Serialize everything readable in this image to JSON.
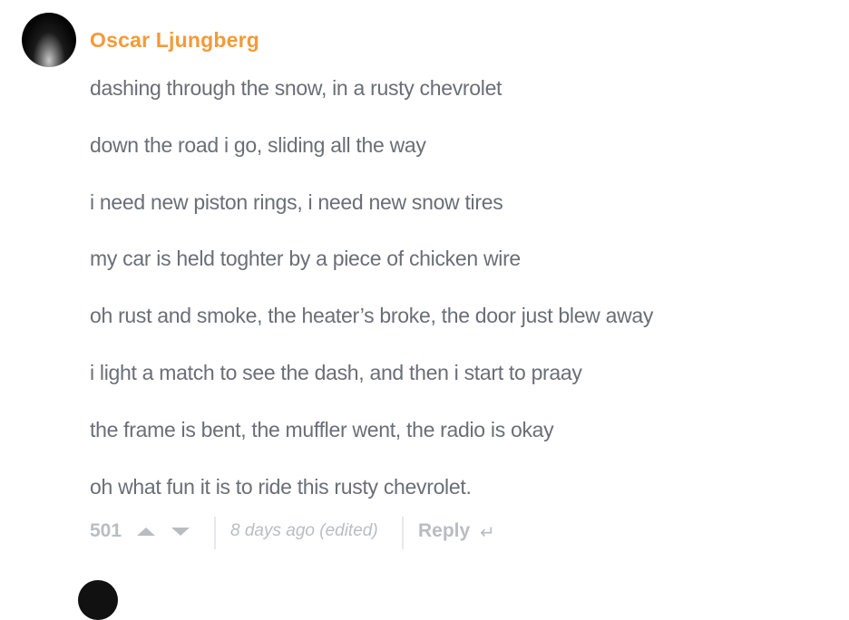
{
  "comment": {
    "author": "Oscar Ljungberg",
    "lines": [
      "dashing through the snow, in a rusty chevrolet",
      "down the road i go, sliding all the way",
      "i need new piston rings, i need new snow tires",
      "my car is held toghter by a piece of chicken wire",
      "oh rust and smoke, the heater’s broke, the door just blew away",
      "i light a match to see the dash, and then i start to praay",
      "the frame is bent, the muffler went, the radio is okay",
      "oh what fun it is to ride this rusty chevrolet."
    ],
    "votes": "501",
    "time": "8 days ago (edited)",
    "reply_label": "Reply",
    "icons": {
      "upvote": "upvote-arrow-icon",
      "downvote": "downvote-arrow-icon",
      "reply": "reply-arrow-icon"
    }
  },
  "colors": {
    "author": "#f59a38",
    "text": "#6a6e76",
    "meta": "#b9bdc2"
  }
}
